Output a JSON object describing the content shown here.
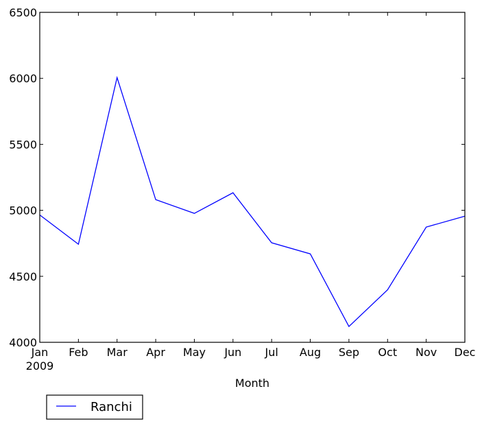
{
  "chart_data": {
    "type": "line",
    "title": "",
    "xlabel": "Month",
    "ylabel": "",
    "categories": [
      "Jan",
      "Feb",
      "Mar",
      "Apr",
      "May",
      "Jun",
      "Jul",
      "Aug",
      "Sep",
      "Oct",
      "Nov",
      "Dec"
    ],
    "x_sublabel": "2009",
    "ylim": [
      4000,
      6500
    ],
    "yticks": [
      4000,
      4500,
      5000,
      5500,
      6000,
      6500
    ],
    "ytick_labels": [
      "4000",
      "4500",
      "5000",
      "5500",
      "6000",
      "6500"
    ],
    "grid": false,
    "series": [
      {
        "name": "Ranchi",
        "color": "#0000ff",
        "values": [
          4965,
          4743,
          6006,
          5081,
          4977,
          5133,
          4754,
          4670,
          4120,
          4398,
          4873,
          4956
        ]
      }
    ],
    "legend": {
      "placement": "below-left",
      "entries": [
        "Ranchi"
      ]
    }
  }
}
